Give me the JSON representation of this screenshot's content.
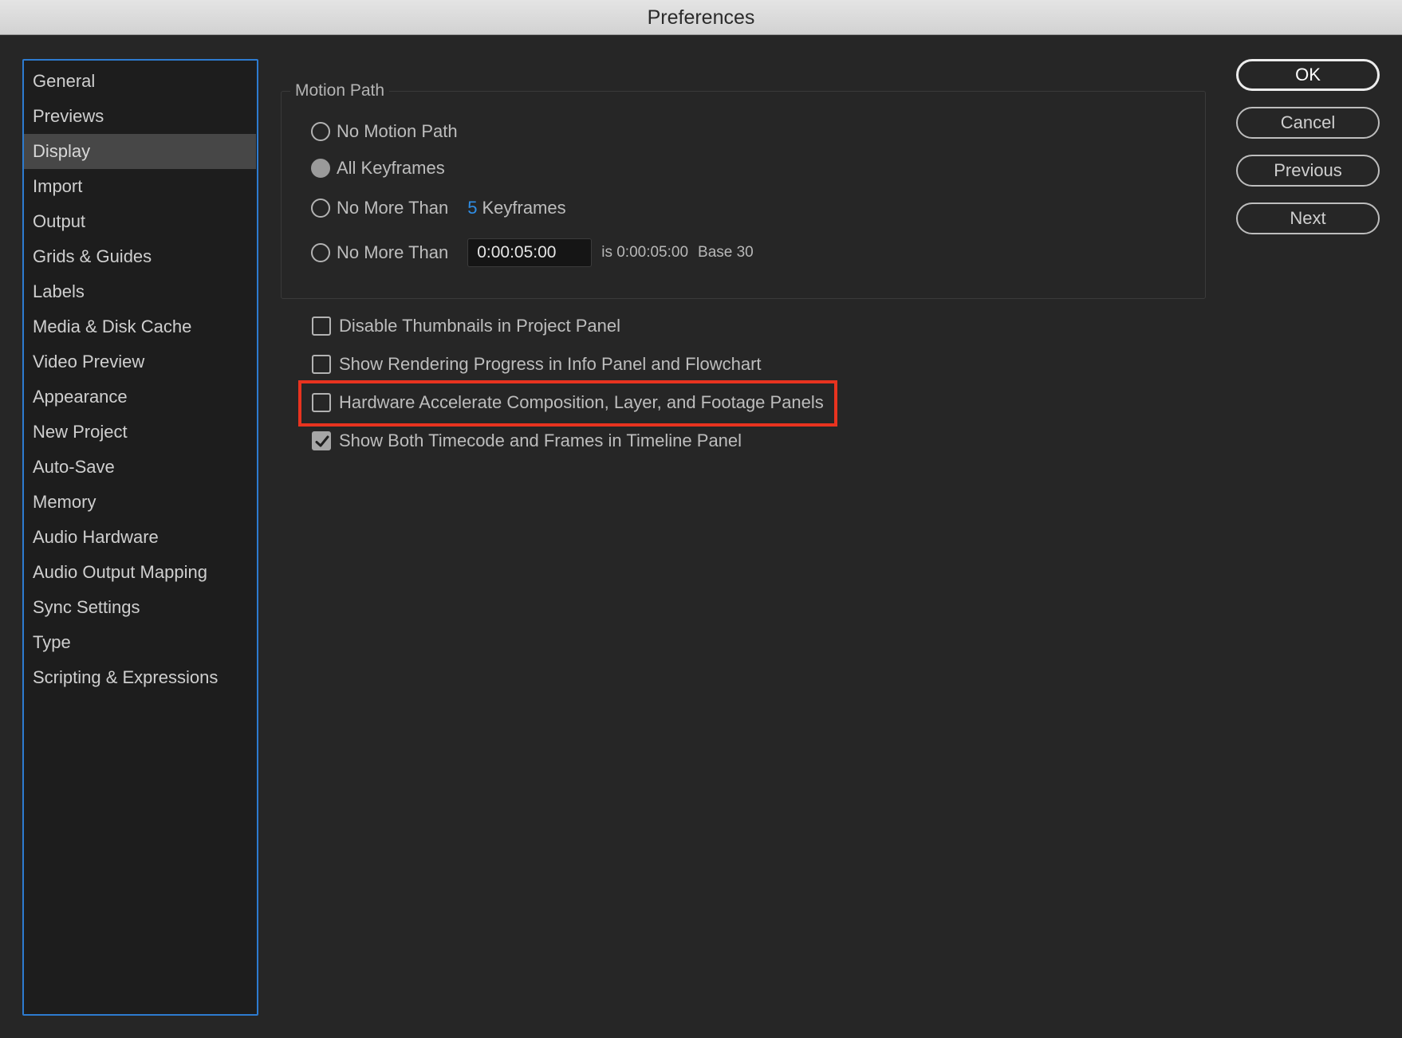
{
  "window": {
    "title": "Preferences"
  },
  "sidebar": {
    "items": [
      {
        "label": "General"
      },
      {
        "label": "Previews"
      },
      {
        "label": "Display",
        "selected": true
      },
      {
        "label": "Import"
      },
      {
        "label": "Output"
      },
      {
        "label": "Grids & Guides"
      },
      {
        "label": "Labels"
      },
      {
        "label": "Media & Disk Cache"
      },
      {
        "label": "Video Preview"
      },
      {
        "label": "Appearance"
      },
      {
        "label": "New Project"
      },
      {
        "label": "Auto-Save"
      },
      {
        "label": "Memory"
      },
      {
        "label": "Audio Hardware"
      },
      {
        "label": "Audio Output Mapping"
      },
      {
        "label": "Sync Settings"
      },
      {
        "label": "Type"
      },
      {
        "label": "Scripting & Expressions"
      }
    ]
  },
  "motion_path": {
    "legend": "Motion Path",
    "options": {
      "none": {
        "label": "No Motion Path",
        "selected": false
      },
      "all": {
        "label": "All Keyframes",
        "selected": true
      },
      "max_keyframes": {
        "label": "No More Than",
        "count": "5",
        "suffix": "Keyframes",
        "selected": false
      },
      "max_time": {
        "label": "No More Than",
        "value": "0:00:05:00",
        "info": "is 0:00:05:00",
        "base": "Base 30",
        "selected": false
      }
    }
  },
  "checkboxes": {
    "disable_thumbnails": {
      "label": "Disable Thumbnails in Project Panel",
      "checked": false
    },
    "show_rendering_progress": {
      "label": "Show Rendering Progress in Info Panel and Flowchart",
      "checked": false
    },
    "hardware_accelerate": {
      "label": "Hardware Accelerate Composition, Layer, and Footage Panels",
      "checked": false
    },
    "show_both_timecode": {
      "label": "Show Both Timecode and Frames in Timeline Panel",
      "checked": true
    }
  },
  "buttons": {
    "ok": "OK",
    "cancel": "Cancel",
    "previous": "Previous",
    "next": "Next"
  },
  "colors": {
    "accent": "#2d7bd0",
    "highlight": "#e8331f",
    "keyframe_number": "#2f8ee6"
  }
}
